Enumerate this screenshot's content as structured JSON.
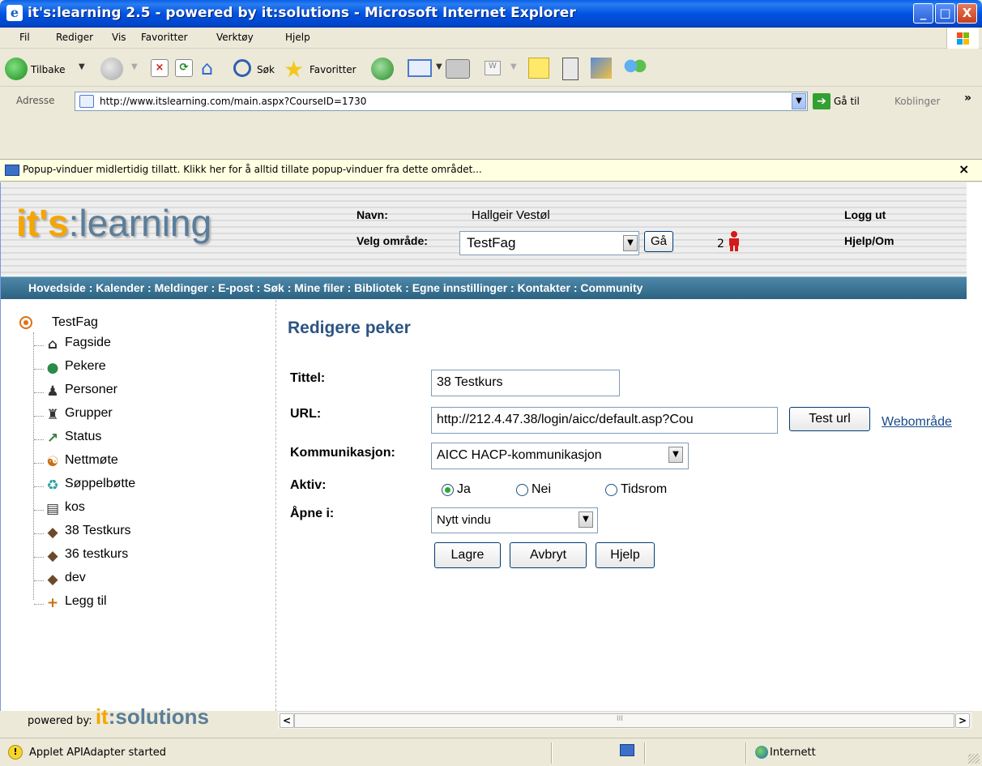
{
  "window": {
    "title": "it's:learning 2.5 - powered by it:solutions - Microsoft Internet Explorer",
    "minimize": "_",
    "maximize": "□",
    "close": "X"
  },
  "menubar": {
    "items": [
      "Fil",
      "Rediger",
      "Vis",
      "Favoritter",
      "Verktøy",
      "Hjelp"
    ]
  },
  "toolbar": {
    "back_label": "Tilbake",
    "search_label": "Søk",
    "favorites_label": "Favoritter"
  },
  "address": {
    "label": "Adresse",
    "url": "http://www.itslearning.com/main.aspx?CourseID=1730",
    "go_label": "Gå til",
    "links_label": "Koblinger",
    "links_chevron": "»"
  },
  "popup_bar": {
    "text": "Popup-vinduer midlertidig tillatt. Klikk her for å alltid tillate popup-vinduer fra dette området...",
    "close": "×"
  },
  "header": {
    "logo_its": "it's",
    "logo_sep": ":",
    "logo_learning": "learning",
    "name_label": "Navn:",
    "name_value": "Hallgeir Vestøl",
    "area_label": "Velg område:",
    "area_value": "TestFag",
    "go_button": "Gå",
    "online_count": "2",
    "logout": "Logg ut",
    "help": "Hjelp/Om"
  },
  "nav": {
    "text": "Hovedside : Kalender : Meldinger : E-post : Søk : Mine filer : Bibliotek : Egne innstillinger : Kontakter : Community"
  },
  "sidebar": {
    "root": "TestFag",
    "items": [
      {
        "label": "Fagside",
        "icon": "house-icon"
      },
      {
        "label": "Pekere",
        "icon": "globe-icon"
      },
      {
        "label": "Personer",
        "icon": "person-icon"
      },
      {
        "label": "Grupper",
        "icon": "group-icon"
      },
      {
        "label": "Status",
        "icon": "chart-icon"
      },
      {
        "label": "Nettmøte",
        "icon": "meeting-icon"
      },
      {
        "label": "Søppelbøtte",
        "icon": "trash-icon"
      },
      {
        "label": "kos",
        "icon": "document-icon"
      },
      {
        "label": "38 Testkurs",
        "icon": "book-icon"
      },
      {
        "label": "36 testkurs",
        "icon": "book-icon"
      },
      {
        "label": "dev",
        "icon": "book-icon"
      },
      {
        "label": "Legg til",
        "icon": "plus-icon"
      }
    ],
    "powered_by": "powered by:",
    "powered_its": "it",
    "powered_sep": ":",
    "powered_solutions": "solutions"
  },
  "form": {
    "title": "Redigere peker",
    "title_label": "Tittel:",
    "title_value": "38 Testkurs",
    "url_label": "URL:",
    "url_value": "http://212.4.47.38/login/aicc/default.asp?Cou",
    "test_url_button": "Test url",
    "web_link": "Webområde",
    "comm_label": "Kommunikasjon:",
    "comm_value": "AICC HACP-kommunikasjon",
    "active_label": "Aktiv:",
    "radio_yes": "Ja",
    "radio_no": "Nei",
    "radio_period": "Tidsrom",
    "active_selected": "Ja",
    "open_label": "Åpne i:",
    "open_value": "Nytt vindu",
    "save_button": "Lagre",
    "cancel_button": "Avbryt",
    "help_button": "Hjelp"
  },
  "statusbar": {
    "text": "Applet APIAdapter started",
    "zone": "Internett"
  },
  "colors": {
    "title_bar": "#0054e3",
    "nav_bar": "#2c6383",
    "logo_orange": "#f5a500",
    "logo_blue": "#5a7d9a",
    "form_title": "#2c5484"
  }
}
